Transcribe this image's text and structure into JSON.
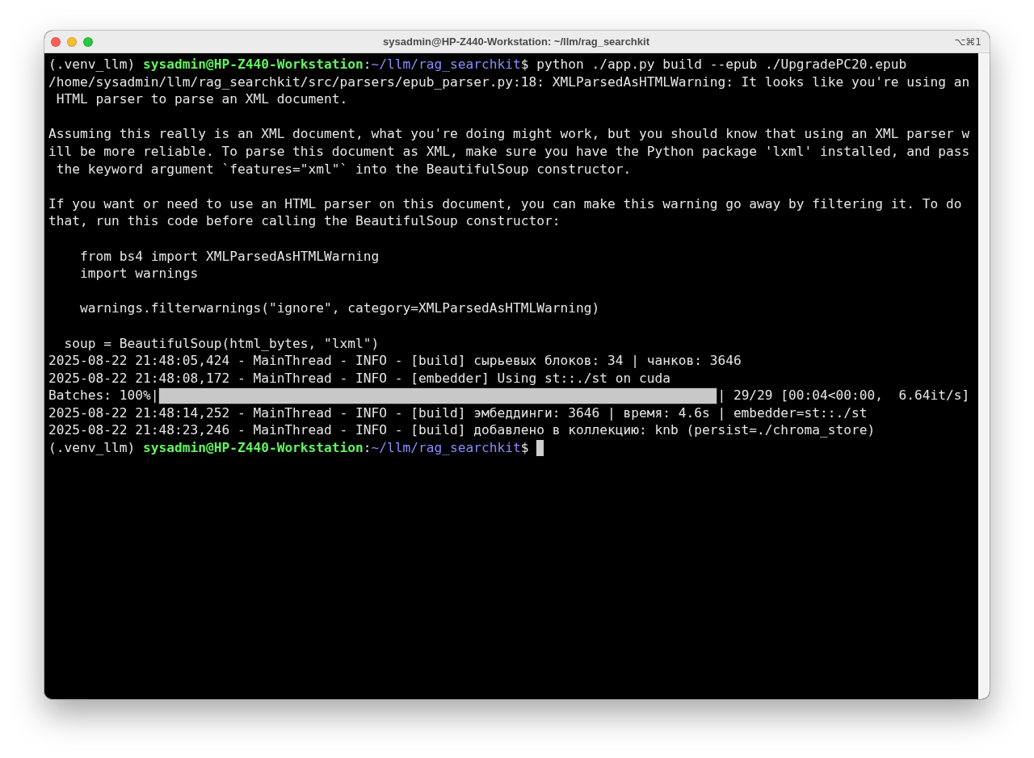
{
  "window": {
    "title": "sysadmin@HP-Z440-Workstation: ~/llm/rag_searchkit",
    "shortcut": "⌥⌘1"
  },
  "terminal": {
    "lines": [
      {
        "kind": "prompt",
        "env": "(.venv_llm)",
        "user_host": "sysadmin@HP-Z440-Workstation",
        "separator": ":",
        "path": "~/llm/rag_searchkit",
        "symbol": "$",
        "command": "python ./app.py build --epub ./UpgradePC20.epub",
        "cursor": false
      },
      {
        "kind": "text",
        "text": "/home/sysadmin/llm/rag_searchkit/src/parsers/epub_parser.py:18: XMLParsedAsHTMLWarning: It looks like you're using an"
      },
      {
        "kind": "text",
        "text": " HTML parser to parse an XML document."
      },
      {
        "kind": "blank"
      },
      {
        "kind": "text",
        "text": "Assuming this really is an XML document, what you're doing might work, but you should know that using an XML parser w"
      },
      {
        "kind": "text",
        "text": "ill be more reliable. To parse this document as XML, make sure you have the Python package 'lxml' installed, and pass"
      },
      {
        "kind": "text",
        "text": " the keyword argument `features=\"xml\"` into the BeautifulSoup constructor."
      },
      {
        "kind": "blank"
      },
      {
        "kind": "text",
        "text": "If you want or need to use an HTML parser on this document, you can make this warning go away by filtering it. To do"
      },
      {
        "kind": "text",
        "text": "that, run this code before calling the BeautifulSoup constructor:"
      },
      {
        "kind": "blank"
      },
      {
        "kind": "text",
        "text": "    from bs4 import XMLParsedAsHTMLWarning"
      },
      {
        "kind": "text",
        "text": "    import warnings"
      },
      {
        "kind": "blank"
      },
      {
        "kind": "text",
        "text": "    warnings.filterwarnings(\"ignore\", category=XMLParsedAsHTMLWarning)"
      },
      {
        "kind": "blank"
      },
      {
        "kind": "text",
        "text": "  soup = BeautifulSoup(html_bytes, \"lxml\")"
      },
      {
        "kind": "text",
        "text": "2025-08-22 21:48:05,424 - MainThread - INFO - [build] сырьевых блоков: 34 | чанков: 3646"
      },
      {
        "kind": "text",
        "text": "2025-08-22 21:48:08,172 - MainThread - INFO - [embedder] Using st::./st on cuda"
      },
      {
        "kind": "progress",
        "label": "Batches: 100%|",
        "level": 1,
        "suffix": "| 29/29 [00:04<00:00,  6.64it/s]"
      },
      {
        "kind": "text",
        "text": "2025-08-22 21:48:14,252 - MainThread - INFO - [build] эмбеддинги: 3646 | время: 4.6s | embedder=st::./st"
      },
      {
        "kind": "text",
        "text": "2025-08-22 21:48:23,246 - MainThread - INFO - [build] добавлено в коллекцию: knb (persist=./chroma_store)"
      },
      {
        "kind": "prompt",
        "env": "(.venv_llm)",
        "user_host": "sysadmin@HP-Z440-Workstation",
        "separator": ":",
        "path": "~/llm/rag_searchkit",
        "symbol": "$",
        "cursor": true
      }
    ]
  }
}
